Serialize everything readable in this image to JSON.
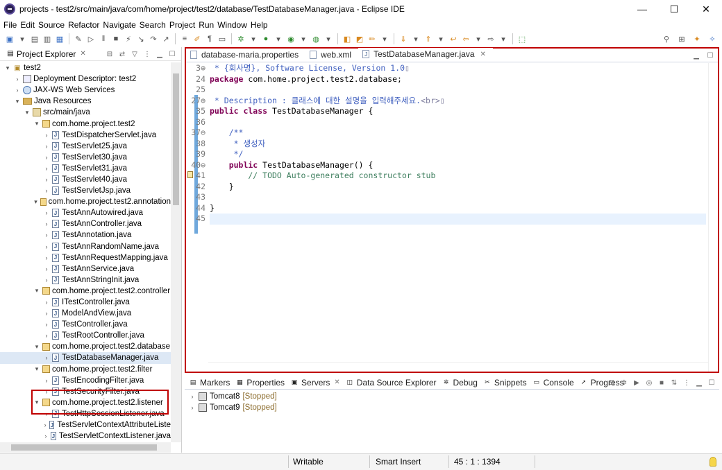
{
  "window": {
    "title": "projects - test2/src/main/java/com/home/project/test2/database/TestDatabaseManager.java - Eclipse IDE",
    "minimize": "—",
    "maximize": "☐",
    "close": "✕"
  },
  "menu": [
    "File",
    "Edit",
    "Source",
    "Refactor",
    "Navigate",
    "Search",
    "Project",
    "Run",
    "Window",
    "Help"
  ],
  "explorer": {
    "title": "Project Explorer",
    "tree": [
      {
        "label": "test2",
        "depth": 0,
        "arrow": "▾",
        "icon": "project"
      },
      {
        "label": "Deployment Descriptor: test2",
        "depth": 1,
        "arrow": "›",
        "icon": "descriptor"
      },
      {
        "label": "JAX-WS Web Services",
        "depth": 1,
        "arrow": "›",
        "icon": "webservice"
      },
      {
        "label": "Java Resources",
        "depth": 1,
        "arrow": "▾",
        "icon": "folder"
      },
      {
        "label": "src/main/java",
        "depth": 2,
        "arrow": "▾",
        "icon": "src"
      },
      {
        "label": "com.home.project.test2",
        "depth": 3,
        "arrow": "▾",
        "icon": "package"
      },
      {
        "label": "TestDispatcherServlet.java",
        "depth": 4,
        "arrow": "›",
        "icon": "java"
      },
      {
        "label": "TestServlet25.java",
        "depth": 4,
        "arrow": "›",
        "icon": "java"
      },
      {
        "label": "TestServlet30.java",
        "depth": 4,
        "arrow": "›",
        "icon": "java"
      },
      {
        "label": "TestServlet31.java",
        "depth": 4,
        "arrow": "›",
        "icon": "java"
      },
      {
        "label": "TestServlet40.java",
        "depth": 4,
        "arrow": "›",
        "icon": "java"
      },
      {
        "label": "TestServletJsp.java",
        "depth": 4,
        "arrow": "›",
        "icon": "java"
      },
      {
        "label": "com.home.project.test2.annotation",
        "depth": 3,
        "arrow": "▾",
        "icon": "package"
      },
      {
        "label": "TestAnnAutowired.java",
        "depth": 4,
        "arrow": "›",
        "icon": "java"
      },
      {
        "label": "TestAnnController.java",
        "depth": 4,
        "arrow": "›",
        "icon": "java"
      },
      {
        "label": "TestAnnotation.java",
        "depth": 4,
        "arrow": "›",
        "icon": "java"
      },
      {
        "label": "TestAnnRandomName.java",
        "depth": 4,
        "arrow": "›",
        "icon": "java"
      },
      {
        "label": "TestAnnRequestMapping.java",
        "depth": 4,
        "arrow": "›",
        "icon": "java"
      },
      {
        "label": "TestAnnService.java",
        "depth": 4,
        "arrow": "›",
        "icon": "java"
      },
      {
        "label": "TestAnnStringInit.java",
        "depth": 4,
        "arrow": "›",
        "icon": "java"
      },
      {
        "label": "com.home.project.test2.controller",
        "depth": 3,
        "arrow": "▾",
        "icon": "package"
      },
      {
        "label": "ITestController.java",
        "depth": 4,
        "arrow": "›",
        "icon": "java"
      },
      {
        "label": "ModelAndView.java",
        "depth": 4,
        "arrow": "›",
        "icon": "java"
      },
      {
        "label": "TestController.java",
        "depth": 4,
        "arrow": "›",
        "icon": "java"
      },
      {
        "label": "TestRootController.java",
        "depth": 4,
        "arrow": "›",
        "icon": "java"
      },
      {
        "label": "com.home.project.test2.database",
        "depth": 3,
        "arrow": "▾",
        "icon": "package"
      },
      {
        "label": "TestDatabaseManager.java",
        "depth": 4,
        "arrow": "›",
        "icon": "java",
        "selected": true
      },
      {
        "label": "com.home.project.test2.filter",
        "depth": 3,
        "arrow": "▾",
        "icon": "package"
      },
      {
        "label": "TestEncodingFilter.java",
        "depth": 4,
        "arrow": "›",
        "icon": "java"
      },
      {
        "label": "TestSecurityFilter.java",
        "depth": 4,
        "arrow": "›",
        "icon": "java"
      },
      {
        "label": "com.home.project.test2.listener",
        "depth": 3,
        "arrow": "▾",
        "icon": "package"
      },
      {
        "label": "TestHttpSessionListener.java",
        "depth": 4,
        "arrow": "›",
        "icon": "java"
      },
      {
        "label": "TestServletContextAttributeListe",
        "depth": 4,
        "arrow": "›",
        "icon": "java"
      },
      {
        "label": "TestServletContextListener.java",
        "depth": 4,
        "arrow": "›",
        "icon": "java"
      }
    ]
  },
  "editor": {
    "tabs": [
      {
        "label": "database-maria.properties",
        "active": false
      },
      {
        "label": "web.xml",
        "active": false
      },
      {
        "label": "TestDatabaseManager.java",
        "active": true
      }
    ],
    "lines": [
      {
        "num": "3⊕",
        "parts": [
          {
            "t": " * {회사명}, Software License, Version 1.0",
            "c": "jd"
          },
          {
            "t": "▯",
            "c": "tag"
          }
        ]
      },
      {
        "num": "24",
        "parts": [
          {
            "t": "package",
            "c": "kw"
          },
          {
            "t": " com.home.project.test2.database;",
            "c": ""
          }
        ]
      },
      {
        "num": "25",
        "parts": []
      },
      {
        "num": "27⊕",
        "parts": [
          {
            "t": " * Description : 클래스에 대한 설명을 입력해주세요.",
            "c": "jd"
          },
          {
            "t": "<br>",
            "c": "tag"
          },
          {
            "t": "▯",
            "c": "tag"
          }
        ]
      },
      {
        "num": "35",
        "parts": [
          {
            "t": "public class",
            "c": "kw"
          },
          {
            "t": " TestDatabaseManager {",
            "c": ""
          }
        ]
      },
      {
        "num": "36",
        "parts": []
      },
      {
        "num": "37⊖",
        "parts": [
          {
            "t": "    /**",
            "c": "jd"
          }
        ]
      },
      {
        "num": "38",
        "parts": [
          {
            "t": "     * 생성자",
            "c": "jd"
          }
        ]
      },
      {
        "num": "39",
        "parts": [
          {
            "t": "     */",
            "c": "jd"
          }
        ]
      },
      {
        "num": "40⊖",
        "parts": [
          {
            "t": "    public",
            "c": "kw"
          },
          {
            "t": " TestDatabaseManager() {",
            "c": ""
          }
        ]
      },
      {
        "num": "41",
        "parts": [
          {
            "t": "        // TODO Auto-generated constructor stub",
            "c": "cm"
          }
        ]
      },
      {
        "num": "42",
        "parts": [
          {
            "t": "    }",
            "c": ""
          }
        ]
      },
      {
        "num": "43",
        "parts": []
      },
      {
        "num": "44",
        "parts": [
          {
            "t": "}",
            "c": ""
          }
        ]
      },
      {
        "num": "45",
        "parts": [],
        "current": true
      }
    ]
  },
  "bottom": {
    "tabs": [
      {
        "label": "Markers",
        "icon": "markers"
      },
      {
        "label": "Properties",
        "icon": "properties"
      },
      {
        "label": "Servers",
        "icon": "servers",
        "active": true
      },
      {
        "label": "Data Source Explorer",
        "icon": "datasource"
      },
      {
        "label": "Debug",
        "icon": "debug"
      },
      {
        "label": "Snippets",
        "icon": "snippets"
      },
      {
        "label": "Console",
        "icon": "console"
      },
      {
        "label": "Progress",
        "icon": "progress"
      }
    ],
    "servers": [
      {
        "name": "Tomcat8",
        "status": "[Stopped]"
      },
      {
        "name": "Tomcat9",
        "status": "[Stopped]"
      }
    ]
  },
  "status": {
    "writable": "Writable",
    "insert_mode": "Smart Insert",
    "position": "45 : 1 : 1394"
  }
}
